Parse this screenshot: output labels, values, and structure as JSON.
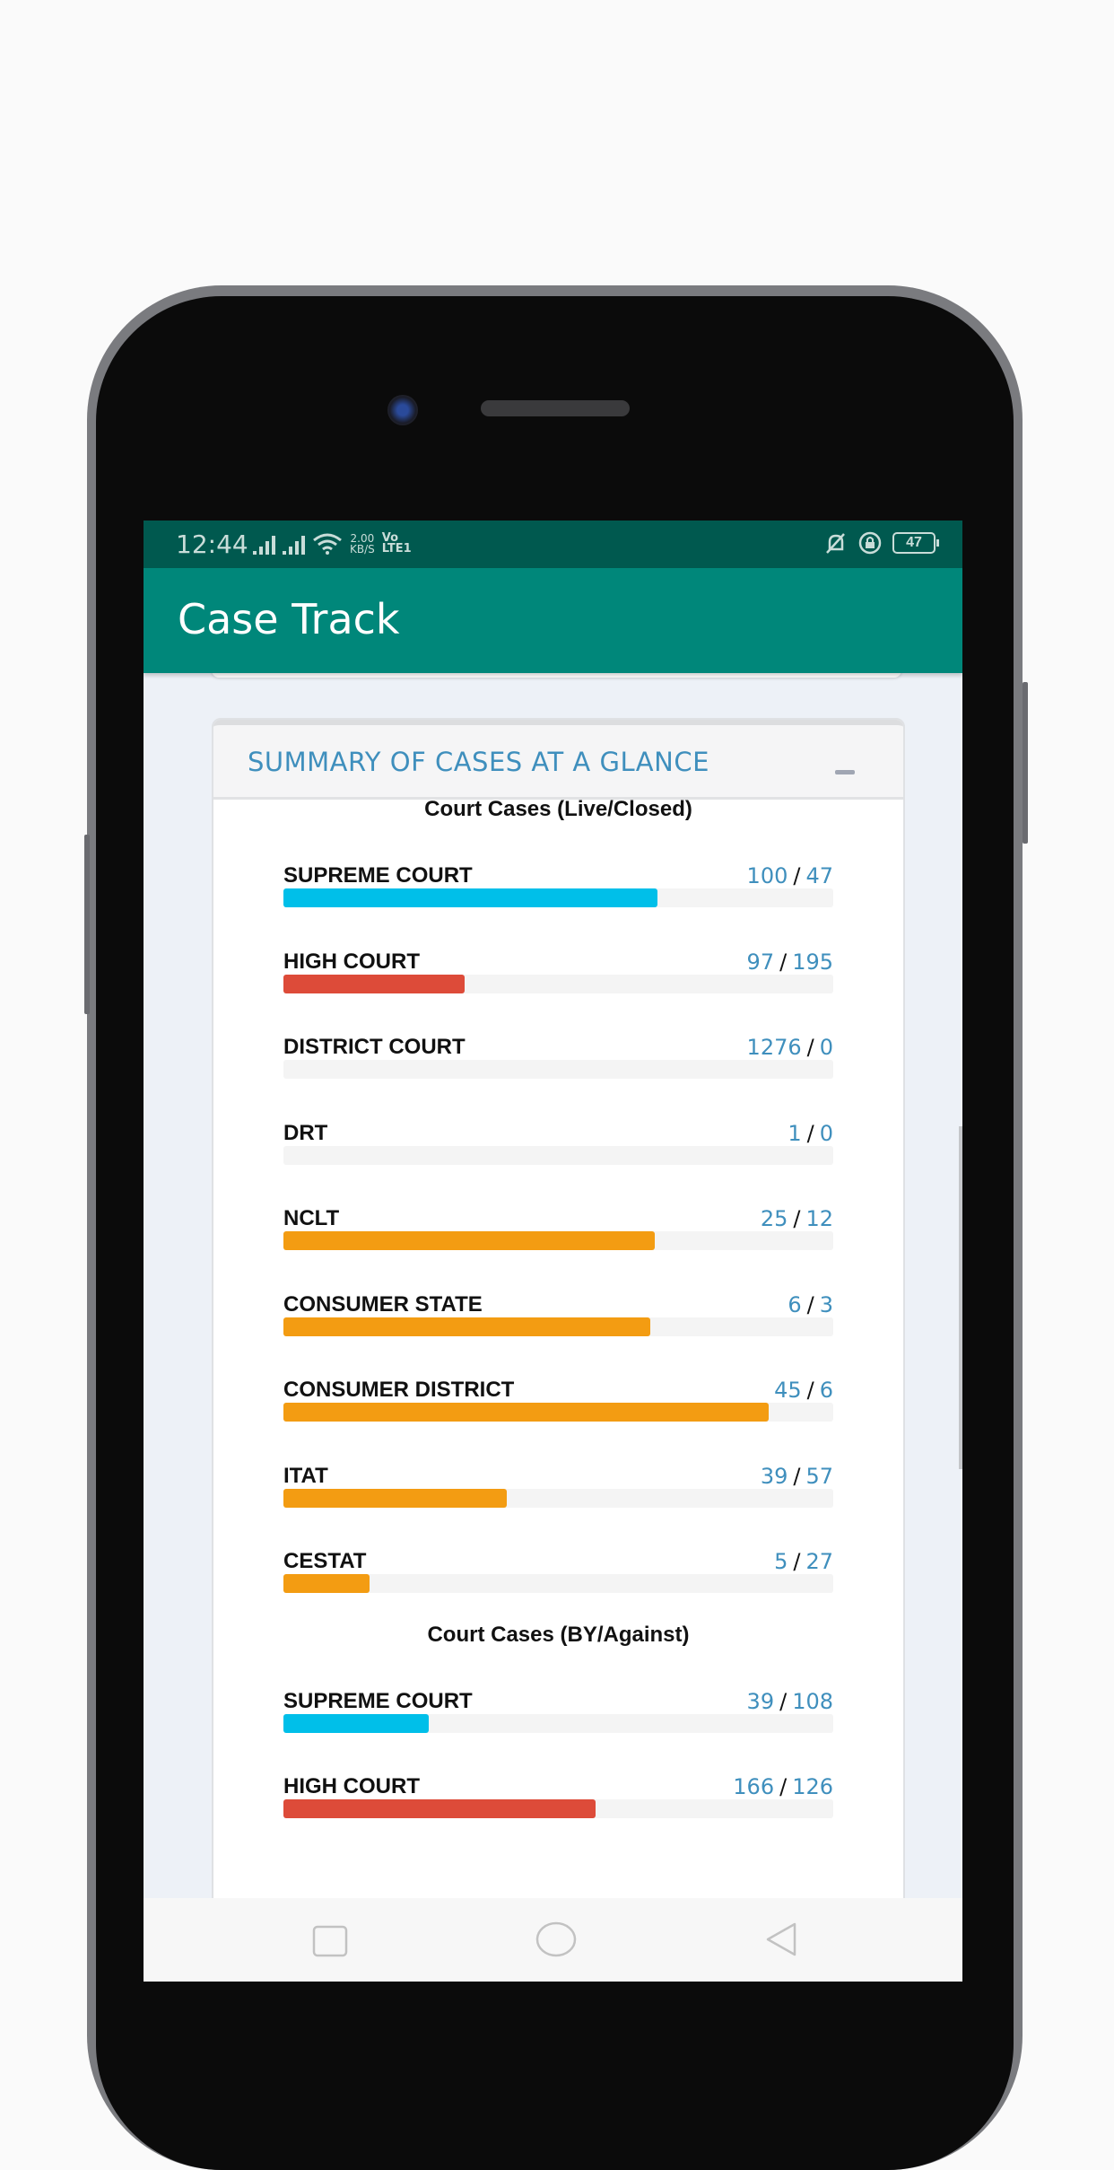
{
  "status_bar": {
    "time": "12:44",
    "speed_value": "2.00",
    "speed_unit": "KB/S",
    "volte_top": "Vo",
    "volte_bottom": "LTE1",
    "battery": "47"
  },
  "app_bar": {
    "title": "Case Track",
    "color": "#00877a"
  },
  "summary_card": {
    "title": "SUMMARY OF CASES AT A GLANCE",
    "collapse_icon": "minus-icon"
  },
  "chart_data": [
    {
      "type": "bar",
      "title": "Court Cases (Live/Closed)",
      "series_names": [
        "Live",
        "Closed"
      ],
      "rows": [
        {
          "label": "SUPREME COURT",
          "a": 100,
          "b": 47,
          "fill": 0.68,
          "color": "#00bfe9"
        },
        {
          "label": "HIGH COURT",
          "a": 97,
          "b": 195,
          "fill": 0.33,
          "color": "#dd4b39"
        },
        {
          "label": "DISTRICT COURT",
          "a": 1276,
          "b": 0,
          "fill": 0,
          "color": "#f39c12"
        },
        {
          "label": "DRT",
          "a": 1,
          "b": 0,
          "fill": 0,
          "color": "#f39c12"
        },
        {
          "label": "NCLT",
          "a": 25,
          "b": 12,
          "fill": 0.676,
          "color": "#f39c12"
        },
        {
          "label": "CONSUMER STATE",
          "a": 6,
          "b": 3,
          "fill": 0.667,
          "color": "#f39c12"
        },
        {
          "label": "CONSUMER DISTRICT",
          "a": 45,
          "b": 6,
          "fill": 0.882,
          "color": "#f39c12"
        },
        {
          "label": "ITAT",
          "a": 39,
          "b": 57,
          "fill": 0.406,
          "color": "#f39c12"
        },
        {
          "label": "CESTAT",
          "a": 5,
          "b": 27,
          "fill": 0.156,
          "color": "#f39c12"
        }
      ]
    },
    {
      "type": "bar",
      "title": "Court Cases (BY/Against)",
      "series_names": [
        "By",
        "Against"
      ],
      "rows": [
        {
          "label": "SUPREME COURT",
          "a": 39,
          "b": 108,
          "fill": 0.265,
          "color": "#00bfe9"
        },
        {
          "label": "HIGH COURT",
          "a": 166,
          "b": 126,
          "fill": 0.568,
          "color": "#dd4b39"
        }
      ]
    }
  ],
  "nav_bar": {
    "recents": "square-recents-icon",
    "home": "circle-home-icon",
    "back": "triangle-back-icon"
  }
}
